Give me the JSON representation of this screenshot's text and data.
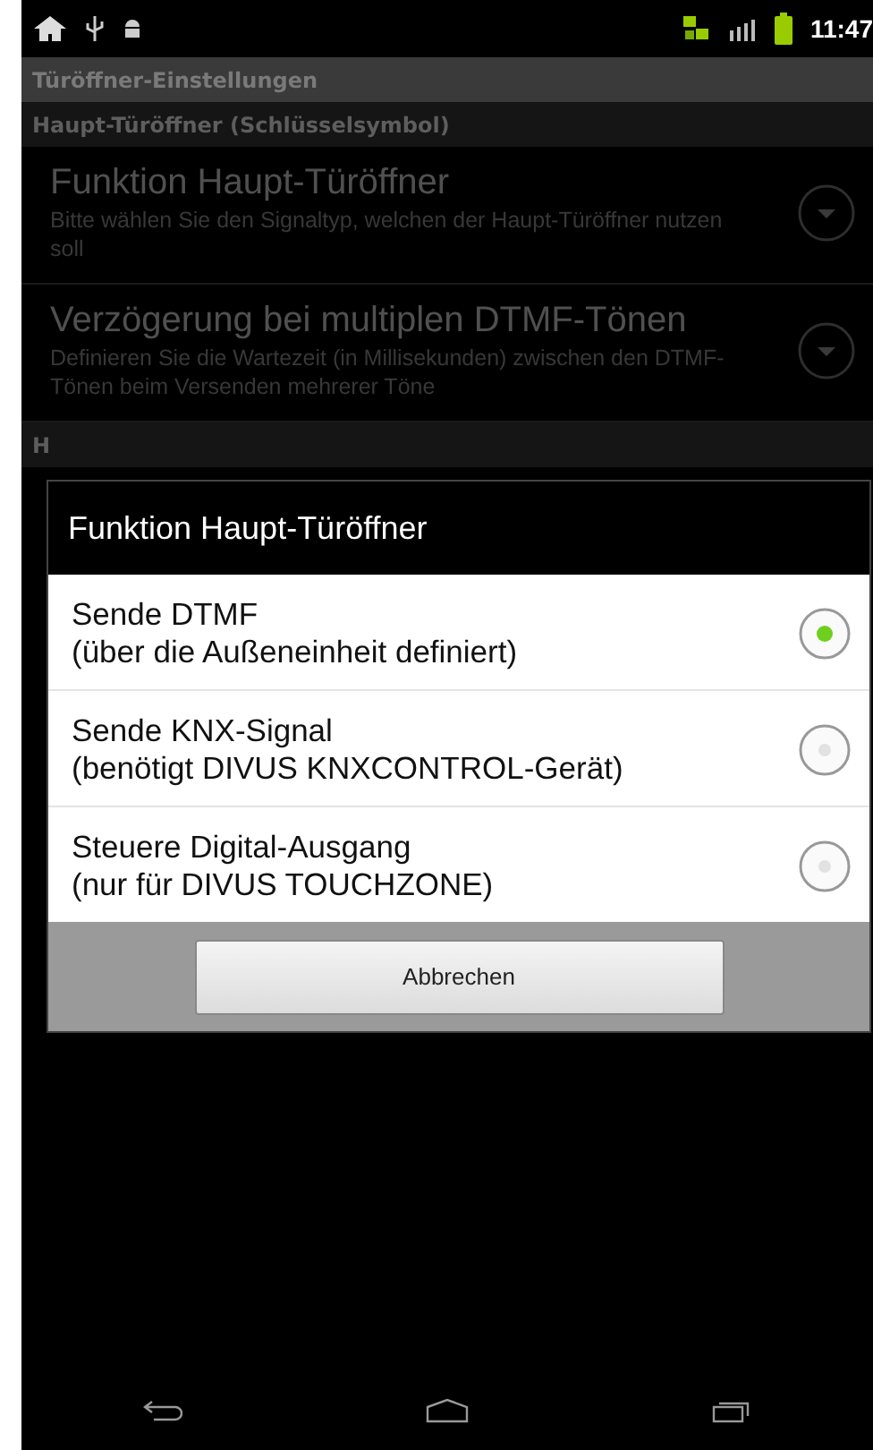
{
  "status_bar": {
    "time": "11:47"
  },
  "title_bar": {
    "title": "Türöffner-Einstellungen"
  },
  "categories": [
    {
      "title": "Haupt-Türöffner (Schlüsselsymbol)",
      "items": [
        {
          "title": "Funktion Haupt-Türöffner",
          "summary": "Bitte wählen Sie den Signaltyp, welchen der Haupt-Türöffner nutzen soll"
        },
        {
          "title": "Verzögerung bei multiplen DTMF-Tönen",
          "summary": "Definieren Sie die Wartezeit (in Millisekunden) zwischen den DTMF-Tönen beim Versenden mehrerer Töne"
        }
      ]
    },
    {
      "title": "H"
    }
  ],
  "dialog": {
    "title": "Funktion Haupt-Türöffner",
    "options": [
      {
        "label": "Sende DTMF",
        "detail": "(über die Außeneinheit definiert)",
        "selected": true
      },
      {
        "label": "Sende KNX-Signal",
        "detail": "(benötigt DIVUS KNXCONTROL-Gerät)",
        "selected": false
      },
      {
        "label": "Steuere Digital-Ausgang",
        "detail": "(nur für DIVUS TOUCHZONE)",
        "selected": false
      }
    ],
    "button": "Abbrechen"
  }
}
